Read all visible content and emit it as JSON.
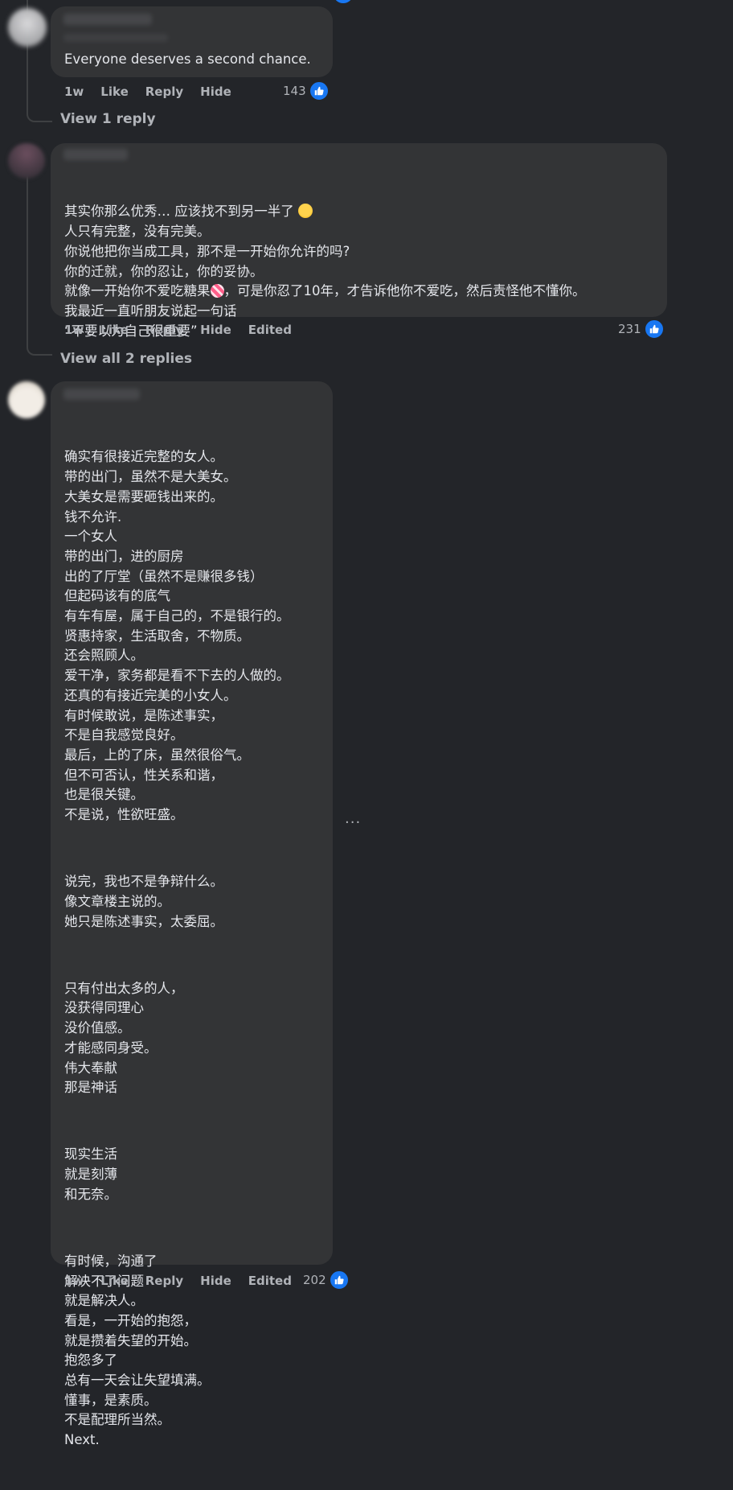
{
  "comments": [
    {
      "text": "Everyone deserves a second chance.",
      "actions": {
        "time": "1w",
        "like": "Like",
        "reply": "Reply",
        "hide": "Hide"
      },
      "reactions": "143",
      "view_replies": "View 1 reply"
    },
    {
      "lines": [
        "其实你那么优秀… 应该找不到另一半了 ",
        "人只有完整，没有完美。",
        "你说他把你当成工具，那不是一开始你允许的吗?",
        "你的迁就，你的忍让，你的妥协。",
        "就像一开始你不爱吃糖果",
        "，可是你忍了10年，才告诉他你不爱吃，然后责怪他不懂你。",
        "我最近一直听朋友说起一句话",
        "“不要以为自己很重要”"
      ],
      "actions": {
        "time": "1w",
        "like": "Like",
        "reply": "Reply",
        "hide": "Hide",
        "edited": "Edited"
      },
      "reactions": "231",
      "view_replies": "View all 2 replies"
    },
    {
      "paragraphs": [
        "确实有很接近完整的女人。\n带的出门，虽然不是大美女。\n大美女是需要砸钱出来的。\n钱不允许.\n一个女人\n带的出门，进的厨房\n出的了厅堂（虽然不是赚很多钱）\n但起码该有的底气\n有车有屋，属于自己的，不是银行的。\n贤惠持家，生活取舍，不物质。\n还会照顾人。\n爱干净，家务都是看不下去的人做的。\n还真的有接近完美的小女人。\n有时候敢说，是陈述事实，\n不是自我感觉良好。\n最后，上的了床，虽然很俗气。\n但不可否认，性关系和谐，\n也是很关键。\n不是说，性欲旺盛。",
        "说完，我也不是争辩什么。\n像文章楼主说的。\n她只是陈述事实，太委屈。",
        "只有付出太多的人，\n没获得同理心\n没价值感。\n才能感同身受。\n伟大奉献\n那是神话",
        "现实生活\n就是刻薄\n和无奈。",
        "有时候，沟通了\n解决不了问题\n就是解决人。\n看是，一开始的抱怨，\n就是攒着失望的开始。\n抱怨多了\n总有一天会让失望填满。\n懂事，是素质。\n不是配理所当然。\nNext."
      ],
      "actions": {
        "time": "1w",
        "like": "Like",
        "reply": "Reply",
        "hide": "Hide",
        "edited": "Edited"
      },
      "reactions": "202",
      "more": "···"
    }
  ],
  "colors": {
    "background": "#232529",
    "bubble": "#333436",
    "accent": "#1877f2",
    "muted": "#b0b3b8"
  },
  "icons": [
    "thumbs-up-icon",
    "laughing-emoji-icon",
    "candy-emoji-icon",
    "more-options-icon"
  ]
}
